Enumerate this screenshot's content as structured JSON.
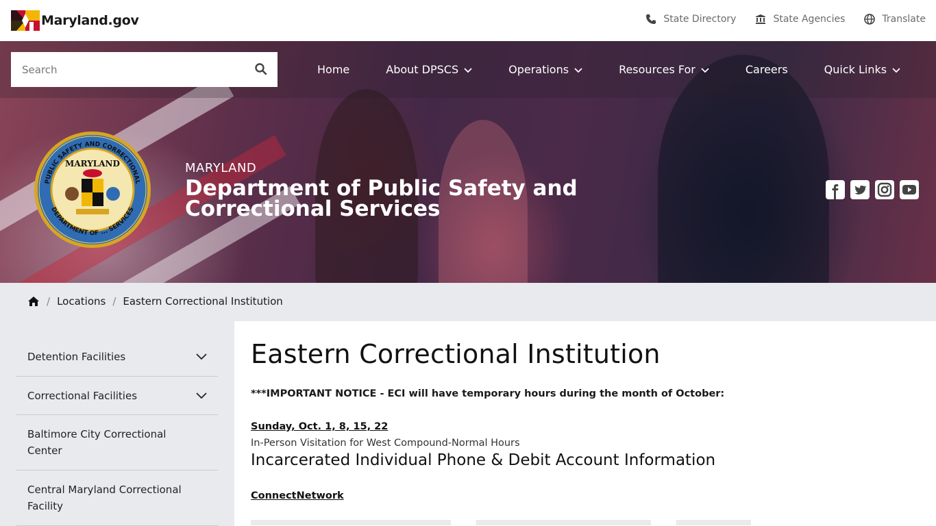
{
  "header": {
    "logo_text": "Maryland.gov",
    "utility_links": [
      {
        "label": "State Directory",
        "icon": "phone-icon"
      },
      {
        "label": "State Agencies",
        "icon": "government-building-icon"
      },
      {
        "label": "Translate",
        "icon": "globe-icon"
      }
    ]
  },
  "search": {
    "placeholder": "Search"
  },
  "nav": {
    "items": [
      {
        "label": "Home",
        "has_dropdown": false
      },
      {
        "label": "About DPSCS",
        "has_dropdown": true
      },
      {
        "label": "Operations",
        "has_dropdown": true
      },
      {
        "label": "Resources For",
        "has_dropdown": true
      },
      {
        "label": "Careers",
        "has_dropdown": false
      },
      {
        "label": "Quick Links",
        "has_dropdown": true
      }
    ]
  },
  "agency": {
    "state": "MARYLAND",
    "name": "Department of Public Safety and Correctional Services",
    "seal_text_top": "PUBLIC SAFETY AND CORRECTIONAL",
    "seal_text_inner": "MARYLAND",
    "seal_text_bottom": "DEPARTMENT OF ... SERVICES"
  },
  "social": [
    "facebook-icon",
    "twitter-icon",
    "instagram-icon",
    "youtube-icon"
  ],
  "breadcrumb": {
    "items": [
      "Locations",
      "Eastern Correctional Institution"
    ]
  },
  "sidebar": {
    "items": [
      {
        "label": "Detention Facilities",
        "expandable": true
      },
      {
        "label": "Correctional Facilities",
        "expandable": true
      },
      {
        "label": "Baltimore City Correctional Center",
        "expandable": false
      },
      {
        "label": "Central Maryland Correctional Facility",
        "expandable": false
      }
    ]
  },
  "main": {
    "title": "Eastern Correctional Institution",
    "notice": "***IMPORTANT NOTICE - ECI will have temporary hours during the month of October:",
    "date_link": "Sunday, Oct. 1, 8, 15, 22",
    "visitation": "In-Person Visitation for West Compound-Normal Hours",
    "subheading": "Incarcerated Individual Phone & Debit Account Information",
    "connect_link": "ConnectNetwork"
  },
  "colors": {
    "hero_overlay": "#4a2a48",
    "seal_gold": "#d9a520",
    "seal_blue": "#2f6cb3",
    "content_bg": "#ffffff",
    "page_bg": "#e8eaed"
  }
}
